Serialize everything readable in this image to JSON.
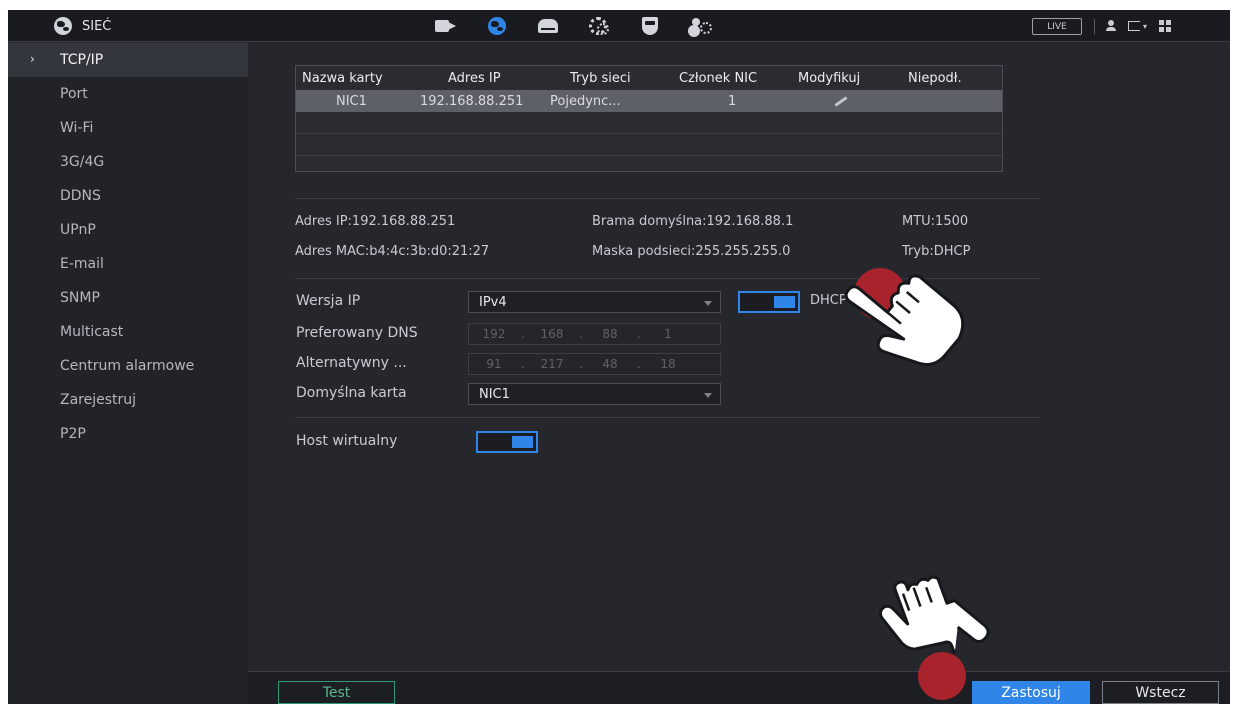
{
  "header": {
    "section_title": "SIEĆ",
    "live_label": "LIVE",
    "nav_icons": [
      "camera-icon",
      "network-globe-icon",
      "storage-icon",
      "system-gears-icon",
      "security-shield-icon",
      "account-icon"
    ],
    "active_nav": "network-globe-icon"
  },
  "sidebar": {
    "items": [
      {
        "label": "TCP/IP",
        "active": true
      },
      {
        "label": "Port"
      },
      {
        "label": "Wi-Fi"
      },
      {
        "label": "3G/4G"
      },
      {
        "label": "DDNS"
      },
      {
        "label": "UPnP"
      },
      {
        "label": "E-mail"
      },
      {
        "label": "SNMP"
      },
      {
        "label": "Multicast"
      },
      {
        "label": "Centrum alarmowe"
      },
      {
        "label": "Zarejestruj"
      },
      {
        "label": "P2P"
      }
    ]
  },
  "nic_table": {
    "columns": [
      "Nazwa karty",
      "Adres IP",
      "Tryb sieci",
      "Członek NIC",
      "Modyfikuj",
      "Niepodł."
    ],
    "rows": [
      {
        "name": "NIC1",
        "ip": "192.168.88.251",
        "mode": "Pojedync...",
        "member": "1",
        "modify_icon": "pencil-icon"
      }
    ]
  },
  "info": {
    "ip": "Adres IP:192.168.88.251",
    "gateway": "Brama domyślna:192.168.88.1",
    "mtu": "MTU:1500",
    "mac": "Adres MAC:b4:4c:3b:d0:21:27",
    "mask": "Maska podsieci:255.255.255.0",
    "mode": "Tryb:DHCP"
  },
  "form": {
    "ip_version_label": "Wersja IP",
    "ip_version_value": "IPv4",
    "dhcp_label": "DHCP",
    "dhcp_on": true,
    "pref_dns_label": "Preferowany DNS",
    "pref_dns": [
      "192",
      "168",
      "88",
      "1"
    ],
    "alt_dns_label": "Alternatywny ...",
    "alt_dns": [
      "91",
      "217",
      "48",
      "18"
    ],
    "default_card_label": "Domyślna karta",
    "default_card_value": "NIC1",
    "virtual_host_label": "Host wirtualny",
    "virtual_host_on": true
  },
  "footer": {
    "test_label": "Test",
    "apply_label": "Zastosuj",
    "back_label": "Wstecz"
  },
  "colors": {
    "accent": "#2f86e8",
    "test_green": "#2f9a70",
    "click_marker": "#a8232b"
  }
}
